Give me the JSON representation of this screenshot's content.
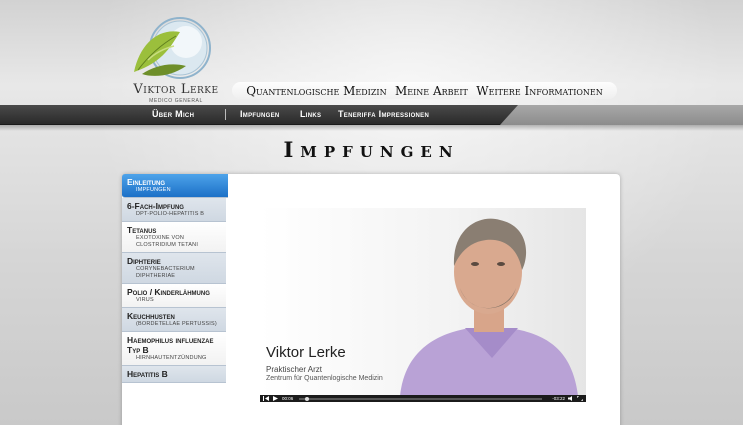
{
  "logo": {
    "name": "Viktor Lerke",
    "subtitle": "Medico General",
    "icon": "leaf-circle-logo"
  },
  "main_nav": [
    {
      "label": "Quantenlogische Medizin"
    },
    {
      "label": "Meine Arbeit"
    },
    {
      "label": "Weitere Informationen"
    }
  ],
  "sub_nav": [
    {
      "label": "Über Mich"
    },
    {
      "label": "Impfungen"
    },
    {
      "label": "Links"
    },
    {
      "label": "Teneriffa Impressionen"
    }
  ],
  "page_title": "Impfungen",
  "sidebar": [
    {
      "title": "Einleitung",
      "sub": "Impfungen",
      "active": true
    },
    {
      "title": "6-Fach-Impfung",
      "sub": "DPT-Polio-Hepatitis B"
    },
    {
      "title": "Tetanus",
      "sub": "Exotoxine von Clostridium tetani"
    },
    {
      "title": "Diphterie",
      "sub": "Corynebacterium diphtheriae"
    },
    {
      "title": "Polio / Kinderlähmung",
      "sub": "Virus"
    },
    {
      "title": "Keuchhusten",
      "sub": "(Bordetellae pertussis)"
    },
    {
      "title": "Haemophilus influenzae Typ B",
      "sub": "Hirnhautentzündung"
    },
    {
      "title": "Hepatitis B",
      "sub": ""
    }
  ],
  "video": {
    "name": "Viktor Lerke",
    "role": "Praktischer Arzt",
    "org": "Zentrum für Quantenlogische Medizin",
    "time_elapsed": "00:06",
    "time_remaining": "-03:22",
    "progress": 0.03
  },
  "colors": {
    "active_blue": "#1c70c7",
    "subbar_dark": "#2a2a2a"
  }
}
